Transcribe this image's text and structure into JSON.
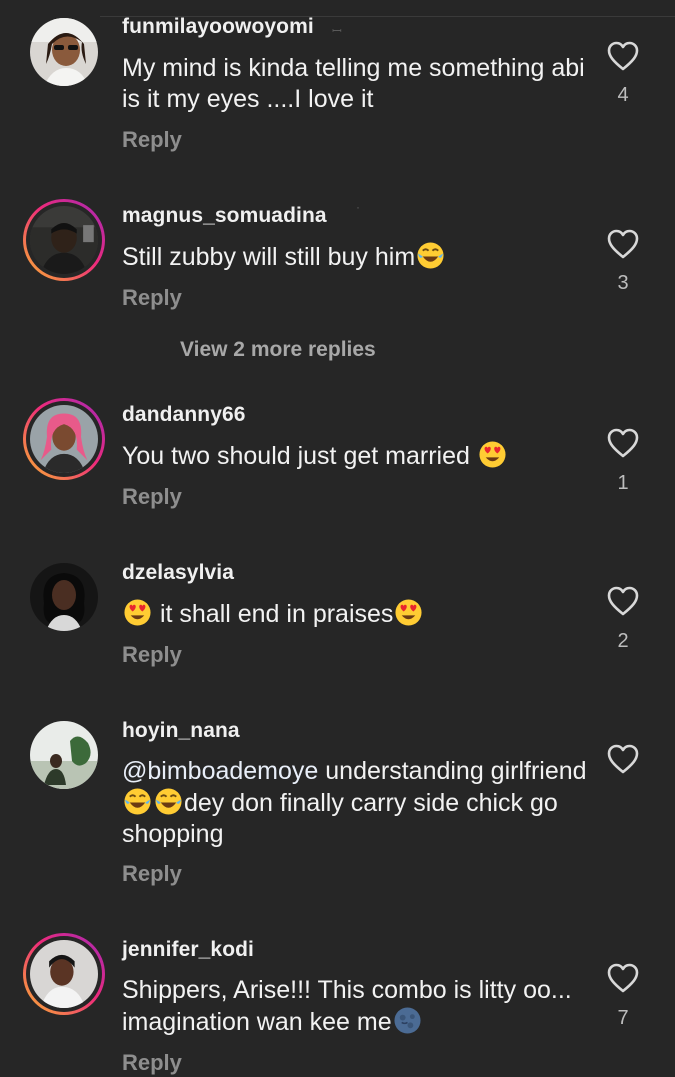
{
  "comments": [
    {
      "username": "funmilayoowoyomi",
      "text_parts": [
        "My mind is kinda telling me something abi is it my eyes ....I love it"
      ],
      "reply_label": "Reply",
      "likes": "4"
    },
    {
      "username": "magnus_somuadina",
      "text_parts": [
        "Still zubby will still buy him"
      ],
      "reply_label": "Reply",
      "likes": "3"
    },
    {
      "username": "dandanny66",
      "text_parts": [
        "You two should just get married "
      ],
      "reply_label": "Reply",
      "likes": "1"
    },
    {
      "username": "dzelasylvia",
      "text_parts": [
        " it shall end in praises"
      ],
      "reply_label": "Reply",
      "likes": "2"
    },
    {
      "username": "hoyin_nana",
      "mention": "@bimboademoye",
      "text_parts": [
        " understanding girlfriend ",
        "dey don finally carry side chick go shopping"
      ],
      "reply_label": "Reply",
      "likes": ""
    },
    {
      "username": "jennifer_kodi",
      "text_parts": [
        "Shippers, Arise!!! This combo is litty oo... imagination wan kee me"
      ],
      "reply_label": "Reply",
      "likes": "7"
    }
  ],
  "view_more_replies": "View 2 more replies",
  "icons": {
    "like": "heart-outline-icon",
    "emoji_joy": "face-with-tears-of-joy-emoji",
    "emoji_hearts": "smiling-face-with-heart-eyes-emoji",
    "emoji_moon": "new-moon-face-emoji"
  },
  "colors": {
    "background": "#262626",
    "text": "#f2f2f2",
    "muted": "#8e8e8e",
    "story_ring_start": "#f9b530",
    "story_ring_end": "#a128b8"
  }
}
